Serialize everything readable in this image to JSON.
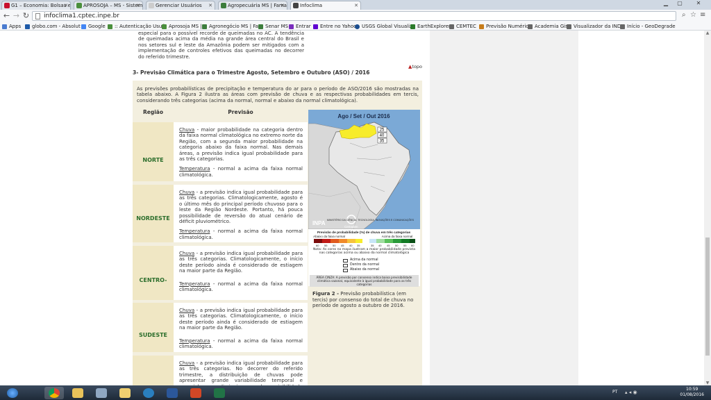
{
  "browser": {
    "tabs": [
      {
        "title": "G1 – Economia: Bolsas e índ",
        "color": "#c8102e",
        "active": false
      },
      {
        "title": "APROSOJA – MS - Sistem",
        "color": "#4a8f3c",
        "active": false
      },
      {
        "title": "Gerenciar Usuários",
        "color": "#cccccc",
        "active": false
      },
      {
        "title": "Agropecuária MS | Famas",
        "color": "#3c7d3c",
        "active": false
      },
      {
        "title": "Infoclima",
        "color": "#444444",
        "active": true
      }
    ],
    "url": "infoclima1.cptec.inpe.br",
    "bookmarks": [
      {
        "label": "Apps",
        "color": "#4a7bd0"
      },
      {
        "label": "globo.com - Absolut",
        "color": "#1e5aa8"
      },
      {
        "label": "Google",
        "color": "#4285f4"
      },
      {
        "label": ":: Autenticação Usuá",
        "color": "#4a8f3c"
      },
      {
        "label": "Aprosoja MS |",
        "color": "#4a8f3c"
      },
      {
        "label": "Agronegócio MS | Fa",
        "color": "#3c7d3c"
      },
      {
        "label": "Senar MS",
        "color": "#3c7d3c"
      },
      {
        "label": "Entrar",
        "color": "#7a2dbd"
      },
      {
        "label": "Entre no Yahoo",
        "color": "#5f01d1"
      },
      {
        "label": "USGS Global Visualiz",
        "color": "#1a4d8f"
      },
      {
        "label": "EarthExplorer",
        "color": "#2a7a2a"
      },
      {
        "label": "CEMTEC",
        "color": "#666666"
      },
      {
        "label": "Previsão Numérica",
        "color": "#c77c1a"
      },
      {
        "label": "Academia Gis",
        "color": "#666666"
      },
      {
        "label": "Visualizador da INDE",
        "color": "#666666"
      },
      {
        "label": "Início - GeoDegrade",
        "color": "#666666"
      }
    ]
  },
  "content": {
    "top_paragraph": "especial para o possível recorde de queimadas no AC. A tendência de queimadas acima da média na grande área central do Brasil e nos setores sul e leste da Amazônia podem ser mitigados com a implementação de controles efetivos das queimadas no decorrer do referido trimestre.",
    "topo_label": "topo",
    "section_title": "3- Previsão Climática para o Trimestre Agosto, Setembro e Outubro (ASO) / 2016",
    "intro": "As previsões probabilísticas de precipitação e temperatura do ar para o período de ASO/2016 são mostradas na tabela abaixo. A Figura 2 ilustra as áreas com previsão de chuva e as respectivas probabilidades em tercis, considerando três categorias (acima da normal, normal e abaixo da normal climatológica).",
    "table": {
      "header_region": "Região",
      "header_forecast": "Previsão",
      "rows": [
        {
          "region": "NORTE",
          "rain_label": "Chuva",
          "rain_text": " - maior probabilidade na categoria dentro da faixa normal climatológica no extremo norte da Região, com a segunda maior probabilidade na categoria abaixo da faixa normal. Nas demais áreas, a previsão indica igual probabilidade para as três categorias.",
          "temp_label": "Temperatura",
          "temp_text": " - normal a acima da faixa normal climatológica."
        },
        {
          "region": "NORDESTE",
          "rain_label": "Chuva",
          "rain_text": " - a previsão indica igual probabilidade para as três categorias. Climatologicamente, agosto é o último mês do principal período chuvoso para o leste da Região Nordeste. Portanto, há pouca possibilidade de reversão do atual cenário de déficit pluviométrico.",
          "temp_label": "Temperatura",
          "temp_text": " - normal a acima da faixa normal climatológica."
        },
        {
          "region": "CENTRO-OESTE",
          "rain_label": "Chuva",
          "rain_text": " - a previsão indica igual probabilidade para as três categorias. Climatologicamente, o início deste período ainda é considerado de estiagem na maior parte da Região.",
          "temp_label": "Temperatura",
          "temp_text": " - normal a acima da faixa normal climatológica."
        },
        {
          "region": "SUDESTE",
          "rain_label": "Chuva",
          "rain_text": " - a previsão indica igual probabilidade para as três categorias. Climatologicamente, o início deste período ainda é considerado de estiagem na maior parte da Região.",
          "temp_label": "Temperatura",
          "temp_text": " - normal a acima da faixa normal climatológica."
        },
        {
          "region": "",
          "rain_label": "Chuva",
          "rain_text": " - a previsão indica igual probabilidade para as três categorias. No decorrer do referido trimestre, a distribuição de chuvas pode apresentar grande variabilidade temporal e espacial, o que diminui o grau de previsibilidade para esta Região.",
          "temp_label": "",
          "temp_text": ""
        }
      ]
    },
    "map": {
      "title": "Ago / Set / Out 2016",
      "legend_values": [
        "25",
        "40",
        "35"
      ],
      "inpa_label": "INPA",
      "cemaden_label": "Cemaden",
      "ministry_label": "MINISTÉRIO DA CIÊNCIA, TECNOLOGIA, INOVAÇÕES E COMUNICAÇÕES",
      "prob_title": "Previsão de probabilidade (%) de chuva em três categorias",
      "below_label": "Abaixo da faixa normal",
      "above_label": "Acima da faixa normal",
      "scale_below": [
        "60",
        "55",
        "50",
        "45",
        "40",
        "35"
      ],
      "scale_above": [
        "35",
        "40",
        "45",
        "50",
        "55",
        "60"
      ],
      "note": "Nota: As cores no mapa ilustram a maior probabilidade prevista nas categorias acima ou abaixo da normal climatológica",
      "key_above": "Acima da normal",
      "key_normal": "Dentro da normal",
      "key_below": "Abaixo da normal",
      "gray_note": "ÁREA CINZA: A previsão por consenso indica baixa previsibilidade climática sazonal, equivalente à igual probabilidade para as três categorias"
    },
    "figure_caption_bold": "Figura 2 -",
    "figure_caption": " Previsão probabilística (em tercis) por consenso do total de chuva no período de agosto a outubro de 2016."
  },
  "system": {
    "language": "PT",
    "time": "10:59",
    "date": "01/08/2016"
  },
  "colors": {
    "accent_green": "#2c6e2c",
    "panel_bg": "#f3efdf",
    "region_bg": "#f0e7c4",
    "map_ocean": "#7ba9d6"
  }
}
